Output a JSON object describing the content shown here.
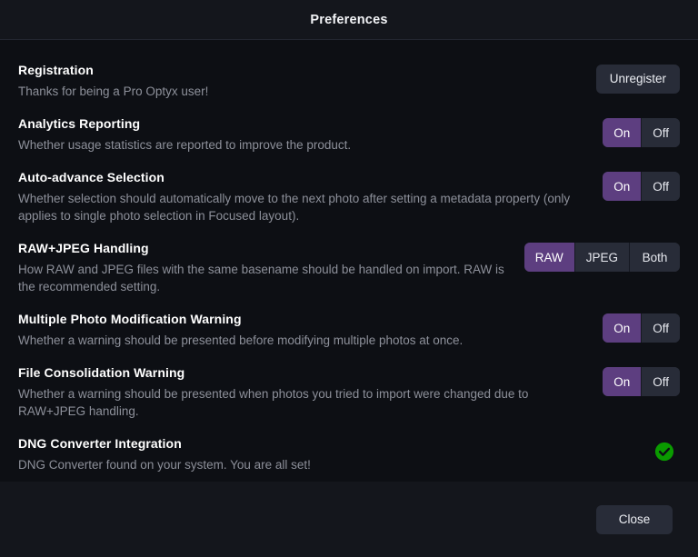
{
  "window": {
    "title": "Preferences"
  },
  "colors": {
    "accent_selected": "#5d3e80",
    "segment_background": "#282c38",
    "status_ok_green": "#0a9b00",
    "title_text": "#ffffff",
    "description_text": "#8d909a",
    "window_background": "#0d0f14",
    "titlebar_background": "#14161c"
  },
  "settings": [
    {
      "title": "Registration",
      "description": "Thanks for being a Pro Optyx user!",
      "control": "button",
      "button_label": "Unregister"
    },
    {
      "title": "Analytics Reporting",
      "description": "Whether usage statistics are reported to improve the product.",
      "control": "segmented",
      "options": [
        "On",
        "Off"
      ],
      "selected": "On"
    },
    {
      "title": "Auto-advance Selection",
      "description": "Whether selection should automatically move to the next photo after setting a metadata property (only applies to single photo selection in Focused layout).",
      "control": "segmented",
      "options": [
        "On",
        "Off"
      ],
      "selected": "On"
    },
    {
      "title": "RAW+JPEG Handling",
      "description": "How RAW and JPEG files with the same basename should be handled on import. RAW is the recommended setting.",
      "control": "segmented",
      "options": [
        "RAW",
        "JPEG",
        "Both"
      ],
      "selected": "RAW"
    },
    {
      "title": "Multiple Photo Modification Warning",
      "description": "Whether a warning should be presented before modifying multiple photos at once.",
      "control": "segmented",
      "options": [
        "On",
        "Off"
      ],
      "selected": "On"
    },
    {
      "title": "File Consolidation Warning",
      "description": "Whether a warning should be presented when photos you tried to import were changed due to RAW+JPEG handling.",
      "control": "segmented",
      "options": [
        "On",
        "Off"
      ],
      "selected": "On"
    },
    {
      "title": "DNG Converter Integration",
      "description": "DNG Converter found on your system. You are all set!",
      "control": "status",
      "status_icon": "green-check-circle-icon"
    }
  ],
  "footer": {
    "close_label": "Close"
  }
}
